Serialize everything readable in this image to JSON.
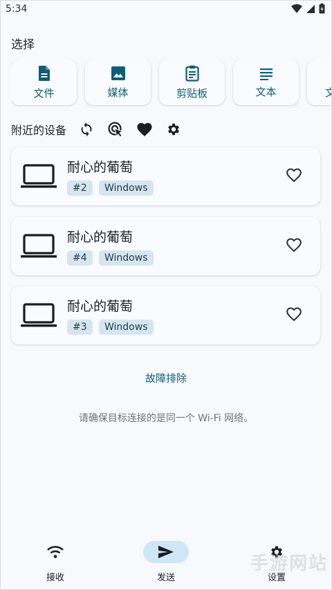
{
  "status_bar": {
    "time": "5:34"
  },
  "choose": {
    "title": "选择",
    "items": [
      {
        "label": "文件",
        "icon": "file-icon"
      },
      {
        "label": "媒体",
        "icon": "image-icon"
      },
      {
        "label": "剪贴板",
        "icon": "clipboard-icon"
      },
      {
        "label": "文本",
        "icon": "text-icon"
      },
      {
        "label": "文",
        "icon": "more-icon"
      }
    ]
  },
  "nearby": {
    "title": "附近的设备",
    "devices": [
      {
        "name": "耐心的葡萄",
        "id": "#2",
        "os": "Windows"
      },
      {
        "name": "耐心的葡萄",
        "id": "#4",
        "os": "Windows"
      },
      {
        "name": "耐心的葡萄",
        "id": "#3",
        "os": "Windows"
      }
    ]
  },
  "troubleshoot": "故障排除",
  "hint": "请确保目标连接的是同一个 Wi-Fi 网络。",
  "nav": {
    "receive": "接收",
    "send": "发送",
    "settings": "设置"
  },
  "watermark": "手游网站",
  "colors": {
    "accent": "#0e5d74",
    "tag_bg": "#d6e6f0",
    "nav_active": "#cfe6f4",
    "background": "#f7f9fc"
  }
}
